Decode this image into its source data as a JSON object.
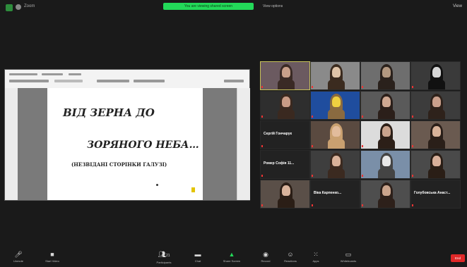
{
  "topbar": {
    "title": "Zoom",
    "sharing_banner": "You are viewing shared screen",
    "view_options": "View options",
    "view_label": "View"
  },
  "slide": {
    "line1": "ВІД ЗЕРНА ДО",
    "line2": "ЗОРЯНОГО НЕБА…",
    "line3": "(НЕЗВІДАНІ СТОРІНКИ ГАЛУЗІ)"
  },
  "participants": [
    {
      "name": "",
      "kind": "video",
      "active": true
    },
    {
      "name": "",
      "kind": "video"
    },
    {
      "name": "",
      "kind": "video"
    },
    {
      "name": "",
      "kind": "video"
    },
    {
      "name": "",
      "kind": "video"
    },
    {
      "name": "",
      "kind": "video"
    },
    {
      "name": "",
      "kind": "video"
    },
    {
      "name": "",
      "kind": "video"
    },
    {
      "name": "",
      "kind": "text",
      "display": "Сергій Гончарук"
    },
    {
      "name": "",
      "kind": "video"
    },
    {
      "name": "",
      "kind": "video"
    },
    {
      "name": "",
      "kind": "video"
    },
    {
      "name": "",
      "kind": "text",
      "display": "Ромер Софія 11..."
    },
    {
      "name": "",
      "kind": "video"
    },
    {
      "name": "",
      "kind": "video"
    },
    {
      "name": "",
      "kind": "video"
    },
    {
      "name": "",
      "kind": "video"
    },
    {
      "name": "",
      "kind": "text",
      "display": "Віка Карпенко..."
    },
    {
      "name": "",
      "kind": "video"
    },
    {
      "name": "",
      "kind": "text",
      "display": "Голубовська Анаст..."
    }
  ],
  "toolbar": {
    "unmute": "Unmute",
    "start_video": "Start Video",
    "participants": "Participants",
    "participants_count": "21",
    "chat": "Chat",
    "share_screen": "Share Screen",
    "record": "Record",
    "reactions": "Reactions",
    "apps": "Apps",
    "whiteboards": "Whiteboards",
    "end": "End"
  },
  "colors": {
    "share_green": "#23d959",
    "end_red": "#e02828",
    "active_speaker": "#c8c25a",
    "background": "#1a1a1a"
  }
}
